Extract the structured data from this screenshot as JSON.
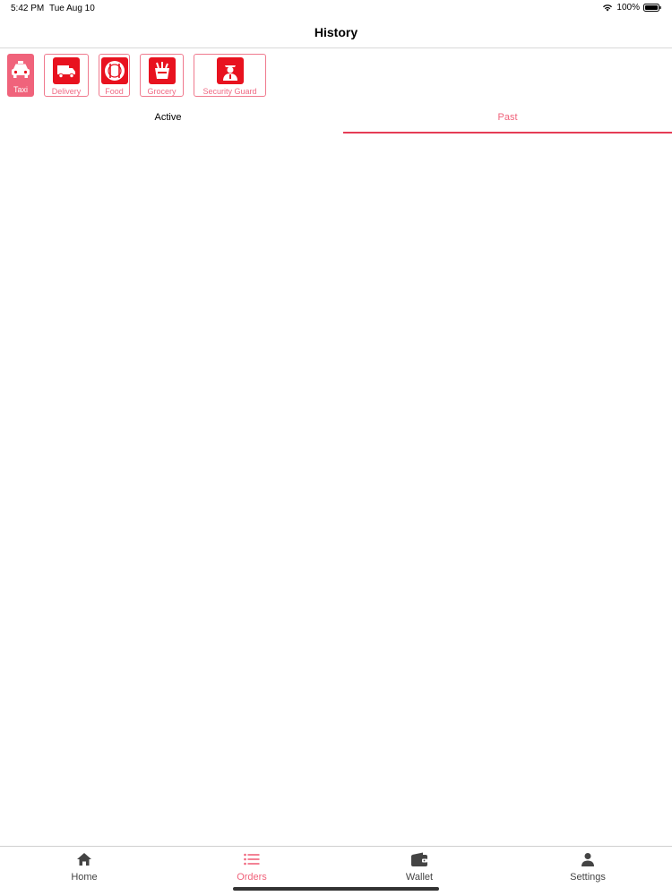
{
  "status_bar": {
    "time": "5:42 PM",
    "date": "Tue Aug 10",
    "battery": "100%"
  },
  "nav": {
    "title": "History"
  },
  "categories": [
    {
      "label": "Taxi",
      "icon": "taxi-icon",
      "selected": true
    },
    {
      "label": "Delivery",
      "icon": "delivery-truck-icon",
      "selected": false
    },
    {
      "label": "Food",
      "icon": "food-plate-icon",
      "selected": false
    },
    {
      "label": "Grocery",
      "icon": "grocery-bag-icon",
      "selected": false
    },
    {
      "label": "Security Guard",
      "icon": "security-guard-icon",
      "selected": false
    }
  ],
  "tabs": {
    "active_label": "Active",
    "past_label": "Past",
    "selected": "Past"
  },
  "tab_bar": {
    "items": [
      {
        "label": "Home",
        "icon": "home-icon",
        "active": false
      },
      {
        "label": "Orders",
        "icon": "list-icon",
        "active": true
      },
      {
        "label": "Wallet",
        "icon": "wallet-icon",
        "active": false
      },
      {
        "label": "Settings",
        "icon": "person-icon",
        "active": false
      }
    ]
  },
  "colors": {
    "accent": "#f0637b",
    "icon_red": "#e8121f",
    "tab_underline": "#e53c55"
  }
}
